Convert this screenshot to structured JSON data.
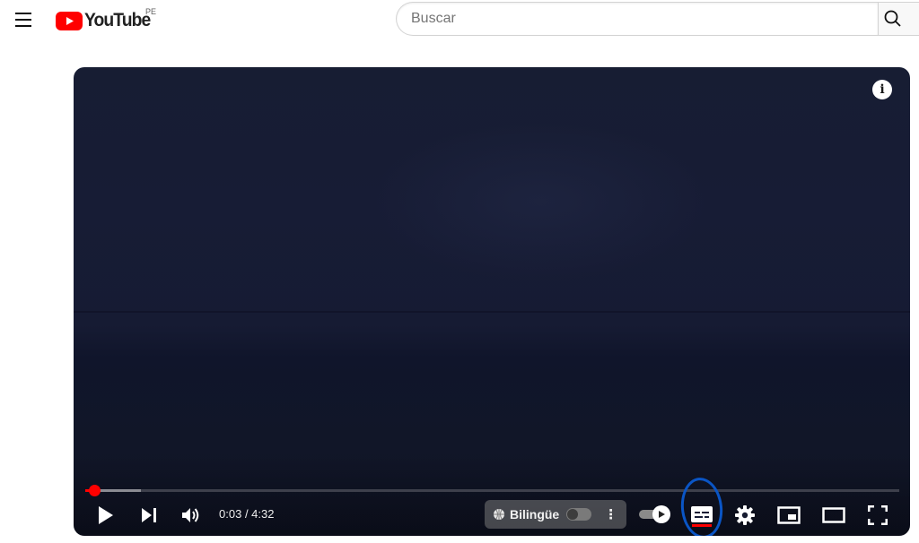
{
  "header": {
    "logo_text": "YouTube",
    "country_code": "PE",
    "search_placeholder": "Buscar",
    "search_value": ""
  },
  "player": {
    "current_time": "0:03",
    "duration": "4:32",
    "time_display": "0:03 / 4:32",
    "progress_fraction": 0.011,
    "buffered_fraction": 0.068,
    "bilingual_label": "Bilingüe",
    "bilingual_enabled": false,
    "autoplay_enabled": true,
    "subtitles_enabled": true
  },
  "colors": {
    "brand_red": "#ff0000",
    "annotation_blue": "#0a55c5",
    "player_background": "#171c35"
  },
  "icons": {
    "menu": "menu-icon",
    "search": "search-icon",
    "info": "info-icon",
    "play": "play-icon",
    "next": "next-icon",
    "volume": "volume-icon",
    "translate": "translate-icon",
    "more": "more-vert-icon",
    "autoplay": "autoplay-icon",
    "subtitles": "subtitles-icon",
    "settings": "settings-icon",
    "miniplayer": "miniplayer-icon",
    "theater": "theater-mode-icon",
    "fullscreen": "fullscreen-icon"
  }
}
